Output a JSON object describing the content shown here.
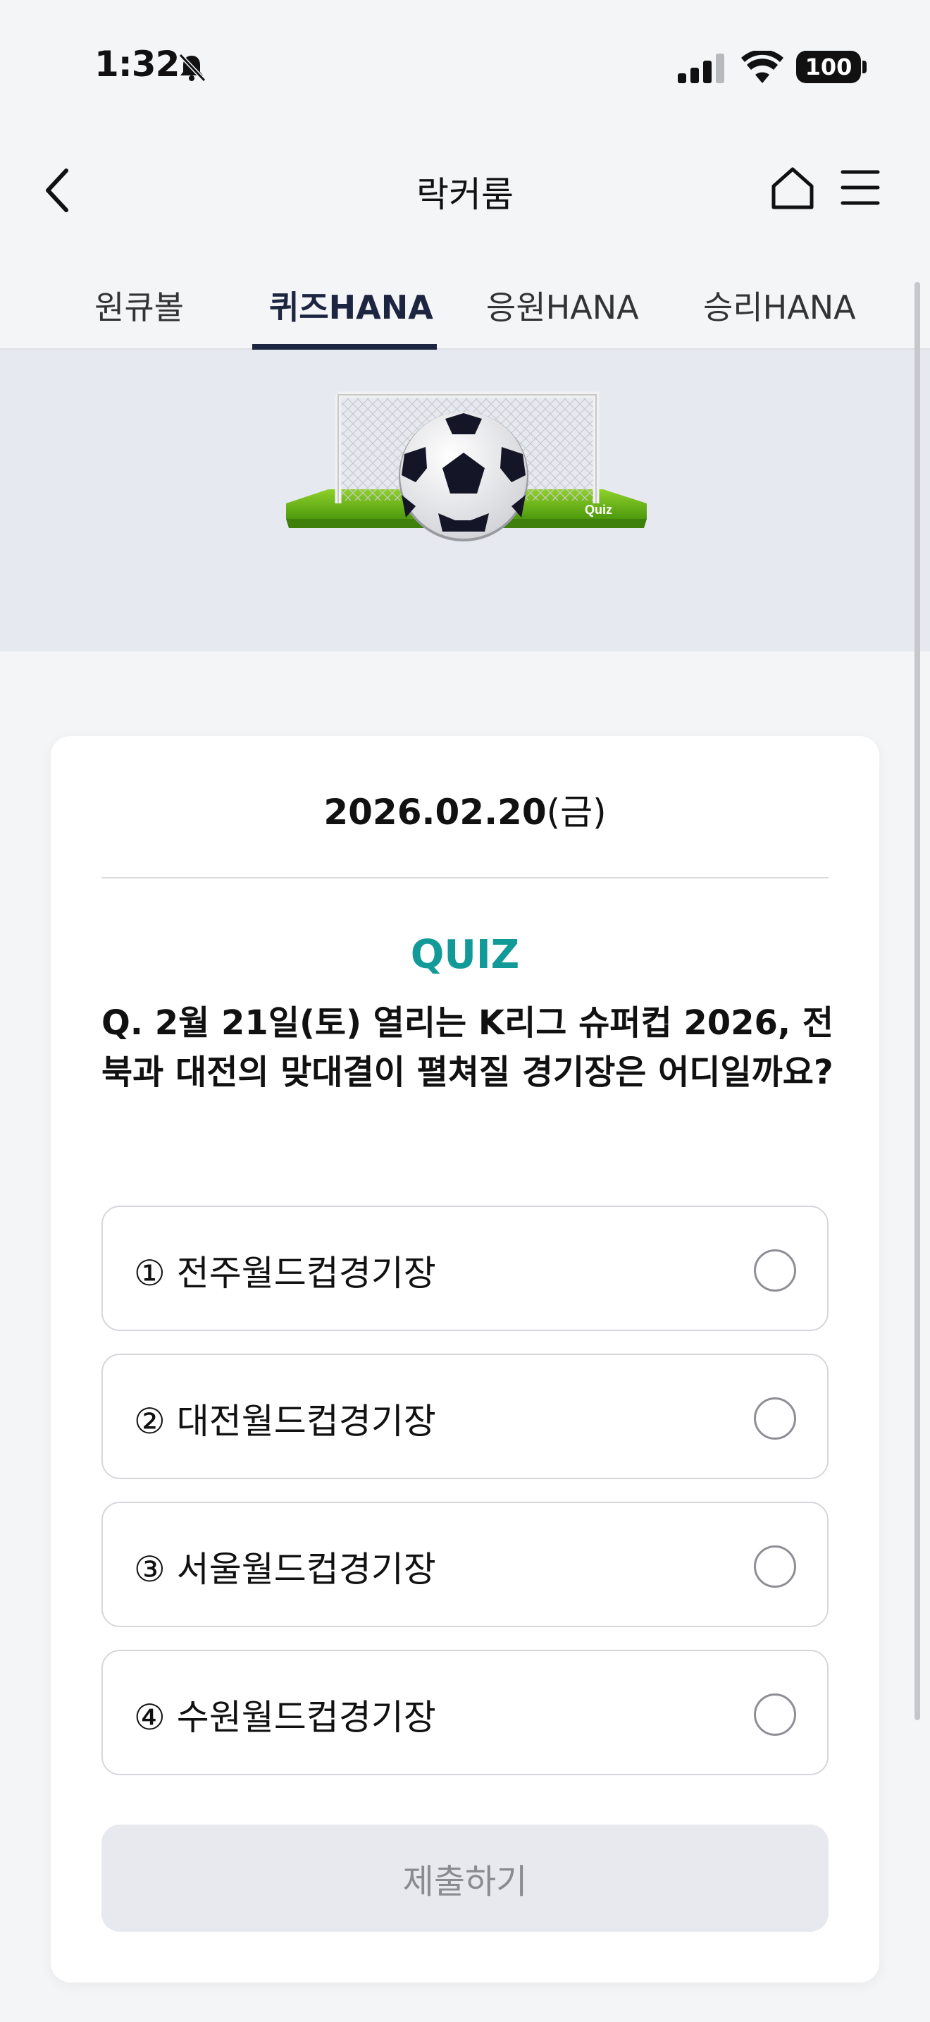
{
  "status_bar": {
    "time": "1:32",
    "battery": "100"
  },
  "header": {
    "title": "락커룸"
  },
  "tabs": [
    {
      "label": "원큐볼",
      "active": false
    },
    {
      "label": "퀴즈HANA",
      "active": true
    },
    {
      "label": "응원HANA",
      "active": false
    },
    {
      "label": "승리HANA",
      "active": false
    }
  ],
  "banner": {
    "badge": "Quiz"
  },
  "quiz": {
    "date": "2026.02.20",
    "weekday": "(금)",
    "label": "QUIZ",
    "question": "Q. 2월 21일(토) 열리는 K리그 슈퍼컵 2026, 전북과 대전의 맞대결이 펼쳐질 경기장은 어디일까요?",
    "options": [
      {
        "label": "① 전주월드컵경기장",
        "selected": false
      },
      {
        "label": "② 대전월드컵경기장",
        "selected": false
      },
      {
        "label": "③ 서울월드컵경기장",
        "selected": false
      },
      {
        "label": "④ 수원월드컵경기장",
        "selected": false
      }
    ],
    "submit_label": "제출하기"
  },
  "colors": {
    "accent": "#129a98",
    "navy": "#1d2640",
    "banner_bg": "#e6e9f0",
    "page_bg": "#f4f5f7"
  }
}
